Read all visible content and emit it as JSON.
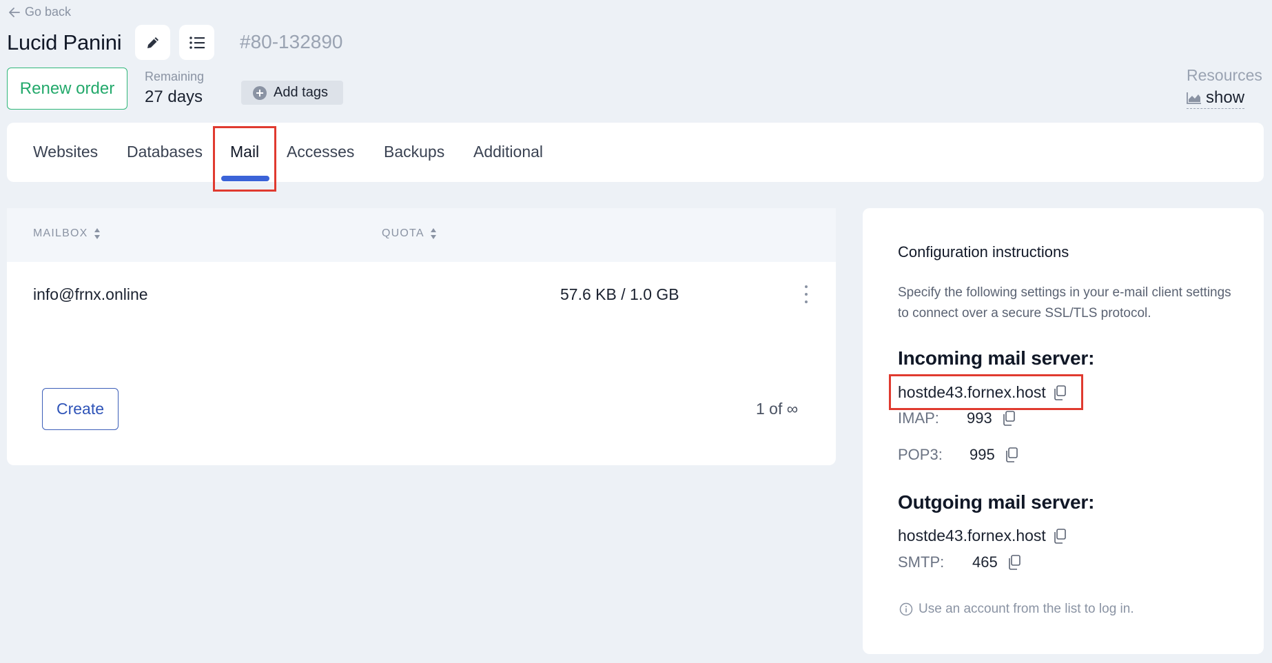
{
  "header": {
    "go_back": "Go back",
    "title": "Lucid Panini",
    "order_id": "80-132890",
    "order_prefix": "#",
    "renew_label": "Renew order",
    "remaining_label": "Remaining",
    "remaining_value": "27 days",
    "add_tags_label": "Add tags",
    "resources_label": "Resources",
    "resources_show": "show"
  },
  "tabs": [
    {
      "label": "Websites"
    },
    {
      "label": "Databases"
    },
    {
      "label": "Mail",
      "active": true
    },
    {
      "label": "Accesses"
    },
    {
      "label": "Backups"
    },
    {
      "label": "Additional"
    }
  ],
  "mail_table": {
    "columns": [
      "MAILBOX",
      "QUOTA"
    ],
    "rows": [
      {
        "mailbox": "info@frnx.online",
        "quota": "57.6 KB / 1.0 GB"
      }
    ],
    "create_label": "Create",
    "pager": "1 of ∞"
  },
  "config": {
    "title": "Configuration instructions",
    "description": "Specify the following settings in your e-mail client settings to connect over a secure SSL/TLS protocol.",
    "incoming": {
      "heading": "Incoming mail server:",
      "host": "hostde43.fornex.host",
      "ports": [
        {
          "label": "IMAP:",
          "value": "993"
        },
        {
          "label": "POP3:",
          "value": "995"
        }
      ]
    },
    "outgoing": {
      "heading": "Outgoing mail server:",
      "host": "hostde43.fornex.host",
      "ports": [
        {
          "label": "SMTP:",
          "value": "465"
        }
      ]
    },
    "hint": "Use an account from the list to log in."
  },
  "colors": {
    "accent": "#3b63d8",
    "renew": "#23a96b",
    "highlight": "#e03a2f",
    "background": "#edf1f6"
  }
}
